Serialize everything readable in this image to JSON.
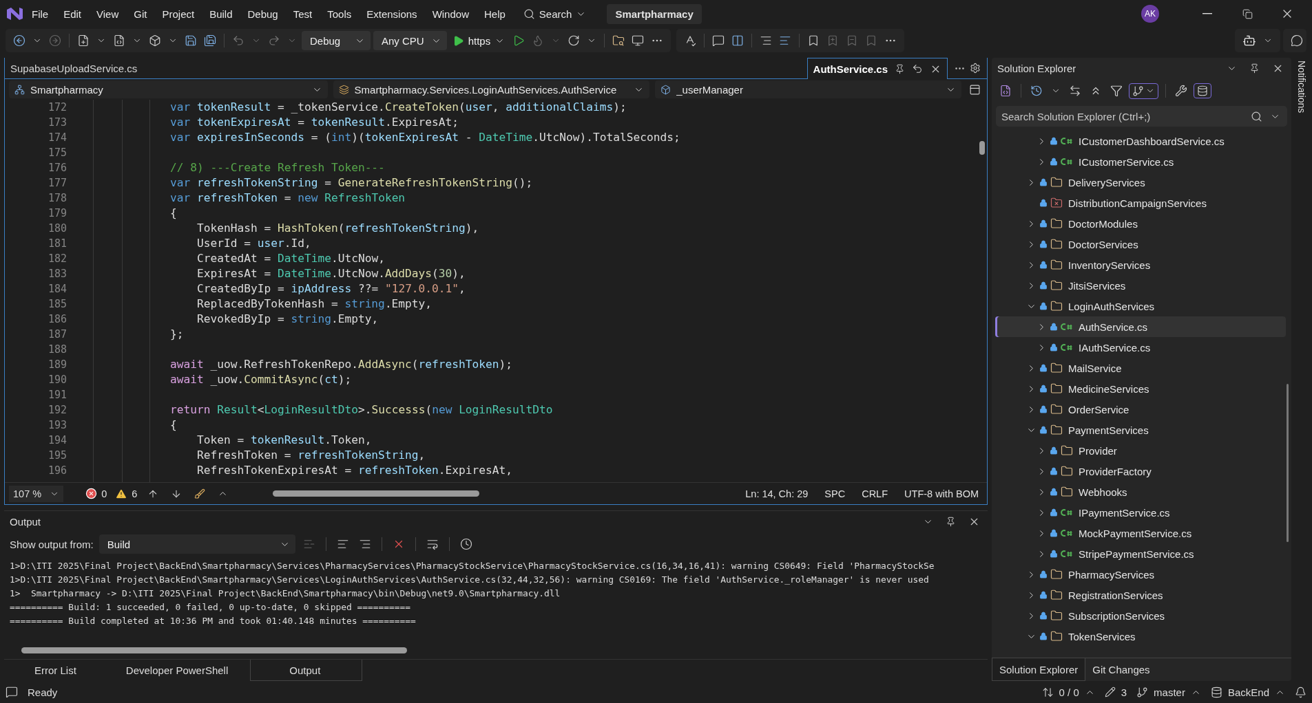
{
  "menu": [
    "File",
    "Edit",
    "View",
    "Git",
    "Project",
    "Build",
    "Debug",
    "Test",
    "Tools",
    "Extensions",
    "Window",
    "Help"
  ],
  "search": {
    "label": "Search"
  },
  "solution_name": "Smartpharmacy",
  "avatar": "AK",
  "toolbar": {
    "configuration": "Debug",
    "platform": "Any CPU",
    "run_target": "https"
  },
  "tabs": [
    {
      "label": "SupabaseUploadService.cs",
      "selected": false
    },
    {
      "label": "AuthService.cs",
      "selected": true
    }
  ],
  "nav_bar": [
    "Smartpharmacy",
    "Smartpharmacy.Services.LoginAuthServices.AuthService",
    "_userManager"
  ],
  "code": [
    {
      "number": "172",
      "tokens": [
        {
          "kind": "keyword",
          "text": "var "
        },
        {
          "kind": "variable",
          "text": "tokenResult"
        },
        {
          "kind": "plain",
          "text": " = _tokenService."
        },
        {
          "kind": "method",
          "text": "CreateToken"
        },
        {
          "kind": "plain",
          "text": "("
        },
        {
          "kind": "variable",
          "text": "user"
        },
        {
          "kind": "plain",
          "text": ", "
        },
        {
          "kind": "variable",
          "text": "additionalClaims"
        },
        {
          "kind": "plain",
          "text": ");"
        }
      ]
    },
    {
      "number": "173",
      "tokens": [
        {
          "kind": "keyword",
          "text": "var "
        },
        {
          "kind": "variable",
          "text": "tokenExpiresAt"
        },
        {
          "kind": "plain",
          "text": " = "
        },
        {
          "kind": "variable",
          "text": "tokenResult"
        },
        {
          "kind": "plain",
          "text": ".ExpiresAt;"
        }
      ]
    },
    {
      "number": "174",
      "tokens": [
        {
          "kind": "keyword",
          "text": "var "
        },
        {
          "kind": "variable",
          "text": "expiresInSeconds"
        },
        {
          "kind": "plain",
          "text": " = ("
        },
        {
          "kind": "keyword",
          "text": "int"
        },
        {
          "kind": "plain",
          "text": ")("
        },
        {
          "kind": "variable",
          "text": "tokenExpiresAt"
        },
        {
          "kind": "plain",
          "text": " - "
        },
        {
          "kind": "type",
          "text": "DateTime"
        },
        {
          "kind": "plain",
          "text": ".UtcNow).TotalSeconds;"
        }
      ]
    },
    {
      "number": "175"
    },
    {
      "number": "176",
      "tokens": [
        {
          "kind": "comment",
          "text": "// 8) ---Create Refresh Token---"
        }
      ]
    },
    {
      "number": "177",
      "tokens": [
        {
          "kind": "keyword",
          "text": "var "
        },
        {
          "kind": "variable",
          "text": "refreshTokenString"
        },
        {
          "kind": "plain",
          "text": " = "
        },
        {
          "kind": "method",
          "text": "GenerateRefreshTokenString"
        },
        {
          "kind": "plain",
          "text": "();"
        }
      ]
    },
    {
      "number": "178",
      "tokens": [
        {
          "kind": "keyword",
          "text": "var "
        },
        {
          "kind": "variable",
          "text": "refreshToken"
        },
        {
          "kind": "plain",
          "text": " = "
        },
        {
          "kind": "keyword",
          "text": "new "
        },
        {
          "kind": "type",
          "text": "RefreshToken"
        }
      ]
    },
    {
      "number": "179",
      "tokens": [
        {
          "kind": "plain",
          "text": "{"
        }
      ]
    },
    {
      "number": "180",
      "tokens": [
        {
          "kind": "plain",
          "text": "    TokenHash = "
        },
        {
          "kind": "method",
          "text": "HashToken"
        },
        {
          "kind": "plain",
          "text": "("
        },
        {
          "kind": "variable",
          "text": "refreshTokenString"
        },
        {
          "kind": "plain",
          "text": "),"
        }
      ]
    },
    {
      "number": "181",
      "tokens": [
        {
          "kind": "plain",
          "text": "    UserId = "
        },
        {
          "kind": "variable",
          "text": "user"
        },
        {
          "kind": "plain",
          "text": ".Id,"
        }
      ]
    },
    {
      "number": "182",
      "tokens": [
        {
          "kind": "plain",
          "text": "    CreatedAt = "
        },
        {
          "kind": "type",
          "text": "DateTime"
        },
        {
          "kind": "plain",
          "text": ".UtcNow,"
        }
      ]
    },
    {
      "number": "183",
      "tokens": [
        {
          "kind": "plain",
          "text": "    ExpiresAt = "
        },
        {
          "kind": "type",
          "text": "DateTime"
        },
        {
          "kind": "plain",
          "text": ".UtcNow."
        },
        {
          "kind": "method",
          "text": "AddDays"
        },
        {
          "kind": "plain",
          "text": "("
        },
        {
          "kind": "number",
          "text": "30"
        },
        {
          "kind": "plain",
          "text": "),"
        }
      ]
    },
    {
      "number": "184",
      "tokens": [
        {
          "kind": "plain",
          "text": "    CreatedByIp = "
        },
        {
          "kind": "variable",
          "text": "ipAddress"
        },
        {
          "kind": "plain",
          "text": " ??= "
        },
        {
          "kind": "string",
          "text": "\"127.0.0.1\""
        },
        {
          "kind": "plain",
          "text": ","
        }
      ]
    },
    {
      "number": "185",
      "tokens": [
        {
          "kind": "plain",
          "text": "    ReplacedByTokenHash = "
        },
        {
          "kind": "keyword",
          "text": "string"
        },
        {
          "kind": "plain",
          "text": ".Empty,"
        }
      ]
    },
    {
      "number": "186",
      "tokens": [
        {
          "kind": "plain",
          "text": "    RevokedByIp = "
        },
        {
          "kind": "keyword",
          "text": "string"
        },
        {
          "kind": "plain",
          "text": ".Empty,"
        }
      ]
    },
    {
      "number": "187",
      "tokens": [
        {
          "kind": "plain",
          "text": "};"
        }
      ]
    },
    {
      "number": "188"
    },
    {
      "number": "189",
      "tokens": [
        {
          "kind": "control",
          "text": "await"
        },
        {
          "kind": "plain",
          "text": " _uow.RefreshTokenRepo."
        },
        {
          "kind": "method",
          "text": "AddAsync"
        },
        {
          "kind": "plain",
          "text": "("
        },
        {
          "kind": "variable",
          "text": "refreshToken"
        },
        {
          "kind": "plain",
          "text": ");"
        }
      ]
    },
    {
      "number": "190",
      "tokens": [
        {
          "kind": "control",
          "text": "await"
        },
        {
          "kind": "plain",
          "text": " _uow."
        },
        {
          "kind": "method",
          "text": "CommitAsync"
        },
        {
          "kind": "plain",
          "text": "("
        },
        {
          "kind": "variable",
          "text": "ct"
        },
        {
          "kind": "plain",
          "text": ");"
        }
      ]
    },
    {
      "number": "191"
    },
    {
      "number": "192",
      "tokens": [
        {
          "kind": "control",
          "text": "return "
        },
        {
          "kind": "type",
          "text": "Result"
        },
        {
          "kind": "plain",
          "text": "<"
        },
        {
          "kind": "type",
          "text": "LoginResultDto"
        },
        {
          "kind": "plain",
          "text": ">."
        },
        {
          "kind": "method",
          "text": "Successs"
        },
        {
          "kind": "plain",
          "text": "("
        },
        {
          "kind": "keyword",
          "text": "new "
        },
        {
          "kind": "type",
          "text": "LoginResultDto"
        }
      ]
    },
    {
      "number": "193",
      "tokens": [
        {
          "kind": "plain",
          "text": "{"
        }
      ]
    },
    {
      "number": "194",
      "tokens": [
        {
          "kind": "plain",
          "text": "    Token = "
        },
        {
          "kind": "variable",
          "text": "tokenResult"
        },
        {
          "kind": "plain",
          "text": ".Token,"
        }
      ]
    },
    {
      "number": "195",
      "tokens": [
        {
          "kind": "plain",
          "text": "    RefreshToken = "
        },
        {
          "kind": "variable",
          "text": "refreshTokenString"
        },
        {
          "kind": "plain",
          "text": ","
        }
      ]
    },
    {
      "number": "196",
      "tokens": [
        {
          "kind": "plain",
          "text": "    RefreshTokenExpiresAt = "
        },
        {
          "kind": "variable",
          "text": "refreshToken"
        },
        {
          "kind": "plain",
          "text": ".ExpiresAt,"
        }
      ]
    }
  ],
  "editor_status": {
    "zoom": "107 %",
    "errors": "0",
    "warnings": "6",
    "position": "Ln: 14, Ch: 29",
    "indent": "SPC",
    "line_ending": "CRLF",
    "encoding": "UTF-8 with BOM"
  },
  "output": {
    "title": "Output",
    "source_label": "Show output from:",
    "source": "Build",
    "lines": [
      "1>D:\\ITI 2025\\Final Project\\BackEnd\\Smartpharmacy\\Services\\PharmacyServices\\PharmacyStockService\\PharmacyStockService.cs(16,34,16,41): warning CS0649: Field 'PharmacyStockSe",
      "1>D:\\ITI 2025\\Final Project\\BackEnd\\Smartpharmacy\\Services\\LoginAuthServices\\AuthService.cs(32,44,32,56): warning CS0169: The field 'AuthService._roleManager' is never used",
      "1>  Smartpharmacy -> D:\\ITI 2025\\Final Project\\BackEnd\\Smartpharmacy\\bin\\Debug\\net9.0\\Smartpharmacy.dll",
      "========== Build: 1 succeeded, 0 failed, 0 up-to-date, 0 skipped ==========",
      "========== Build completed at 10:36 PM and took 01:40.148 minutes =========="
    ]
  },
  "bottom_tabs": [
    {
      "label": "Error List",
      "selected": false
    },
    {
      "label": "Developer PowerShell",
      "selected": false
    },
    {
      "label": "Output",
      "selected": true
    }
  ],
  "solution_explorer": {
    "title": "Solution Explorer",
    "search_placeholder": "Search Solution Explorer (Ctrl+;)",
    "tree": [
      {
        "kind": "group",
        "children": [
          {
            "kind": "file",
            "label": "ICustomerDashboardService.cs",
            "expanded": false,
            "selected": false
          },
          {
            "kind": "file",
            "label": "ICustomerService.cs",
            "expanded": false,
            "selected": false
          }
        ]
      },
      {
        "kind": "folder",
        "label": "DeliveryServices",
        "expanded": false,
        "selected": false
      },
      {
        "kind": "excluded",
        "label": "DistributionCampaignServices",
        "selected": false
      },
      {
        "kind": "folder",
        "label": "DoctorModules",
        "expanded": false,
        "selected": false
      },
      {
        "kind": "folder",
        "label": "DoctorServices",
        "expanded": false,
        "selected": false
      },
      {
        "kind": "folder",
        "label": "InventoryServices",
        "expanded": false,
        "selected": false
      },
      {
        "kind": "folder",
        "label": "JitsiServices",
        "expanded": false,
        "selected": false
      },
      {
        "kind": "folder",
        "label": "LoginAuthServices",
        "expanded": true,
        "selected": false,
        "children": [
          {
            "kind": "file",
            "label": "AuthService.cs",
            "expanded": false,
            "selected": true
          },
          {
            "kind": "file",
            "label": "IAuthService.cs",
            "expanded": false,
            "selected": false
          }
        ]
      },
      {
        "kind": "folder",
        "label": "MailService",
        "expanded": false,
        "selected": false
      },
      {
        "kind": "folder",
        "label": "MedicineServices",
        "expanded": false,
        "selected": false
      },
      {
        "kind": "folder",
        "label": "OrderService",
        "expanded": false,
        "selected": false
      },
      {
        "kind": "folder",
        "label": "PaymentServices",
        "expanded": true,
        "selected": false,
        "children": [
          {
            "kind": "folder",
            "label": "Provider",
            "expanded": false,
            "selected": false
          },
          {
            "kind": "folder",
            "label": "ProviderFactory",
            "expanded": false,
            "selected": false
          },
          {
            "kind": "folder",
            "label": "Webhooks",
            "expanded": false,
            "selected": false
          },
          {
            "kind": "file",
            "label": "IPaymentService.cs",
            "expanded": false,
            "selected": false
          },
          {
            "kind": "file",
            "label": "MockPaymentService.cs",
            "expanded": false,
            "selected": false
          },
          {
            "kind": "file",
            "label": "StripePaymentService.cs",
            "expanded": false,
            "selected": false
          }
        ]
      },
      {
        "kind": "folder",
        "label": "PharmacyServices",
        "expanded": false,
        "selected": false
      },
      {
        "kind": "folder",
        "label": "RegistrationServices",
        "expanded": false,
        "selected": false
      },
      {
        "kind": "folder",
        "label": "SubscriptionServices",
        "expanded": false,
        "selected": false
      },
      {
        "kind": "folder",
        "label": "TokenServices",
        "expanded": true,
        "selected": false
      }
    ]
  },
  "side_tabs": [
    {
      "label": "Solution Explorer",
      "selected": true
    },
    {
      "label": "Git Changes",
      "selected": false
    }
  ],
  "notifications": "Notifications",
  "status_bar": {
    "state": "Ready",
    "sync": "0 / 0",
    "changes": "3",
    "branch": "master",
    "repository": "BackEnd"
  }
}
